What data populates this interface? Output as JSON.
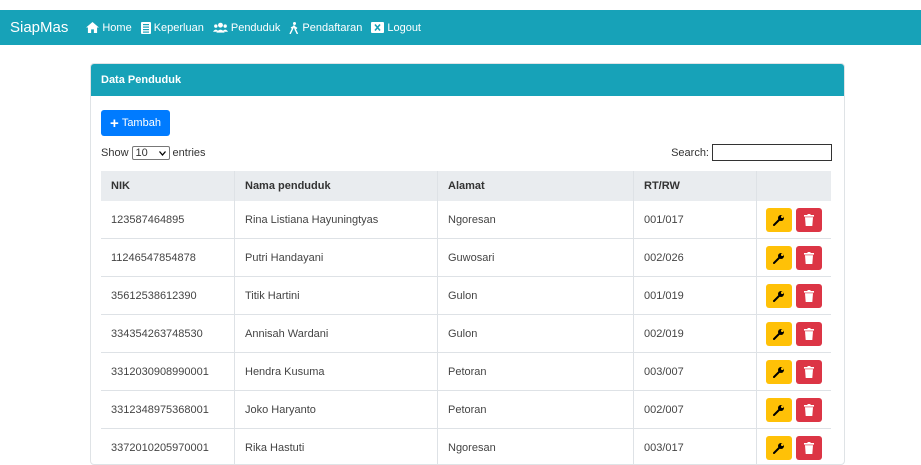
{
  "navbar": {
    "brand": "SiapMas",
    "items": [
      {
        "label": "Home",
        "icon": "home-icon"
      },
      {
        "label": "Keperluan",
        "icon": "book-icon"
      },
      {
        "label": "Penduduk",
        "icon": "users-icon"
      },
      {
        "label": "Pendaftaran",
        "icon": "walking-icon"
      },
      {
        "label": "Logout",
        "icon": "window-close-icon"
      }
    ]
  },
  "card": {
    "title": "Data Penduduk",
    "add_label": "Tambah",
    "show_label": "Show",
    "entries_value": "10",
    "entries_label": "entries",
    "search_label": "Search:",
    "search_value": ""
  },
  "table": {
    "columns": [
      "NIK",
      "Nama penduduk",
      "Alamat",
      "RT/RW",
      ""
    ],
    "rows": [
      {
        "nik": "123587464895",
        "nama": "Rina Listiana Hayuningtyas",
        "alamat": "Ngoresan",
        "rtrw": "001/017"
      },
      {
        "nik": "11246547854878",
        "nama": "Putri Handayani",
        "alamat": "Guwosari",
        "rtrw": "002/026"
      },
      {
        "nik": "35612538612390",
        "nama": "Titik Hartini",
        "alamat": "Gulon",
        "rtrw": "001/019"
      },
      {
        "nik": "334354263748530",
        "nama": "Annisah Wardani",
        "alamat": "Gulon",
        "rtrw": "002/019"
      },
      {
        "nik": "3312030908990001",
        "nama": "Hendra Kusuma",
        "alamat": "Petoran",
        "rtrw": "003/007"
      },
      {
        "nik": "3312348975368001",
        "nama": "Joko Haryanto",
        "alamat": "Petoran",
        "rtrw": "002/007"
      },
      {
        "nik": "3372010205970001",
        "nama": "Rika Hastuti",
        "alamat": "Ngoresan",
        "rtrw": "003/017"
      }
    ]
  },
  "colors": {
    "primary": "#17a2b8",
    "add_button": "#007bff",
    "edit_button": "#ffc107",
    "delete_button": "#dc3545"
  }
}
